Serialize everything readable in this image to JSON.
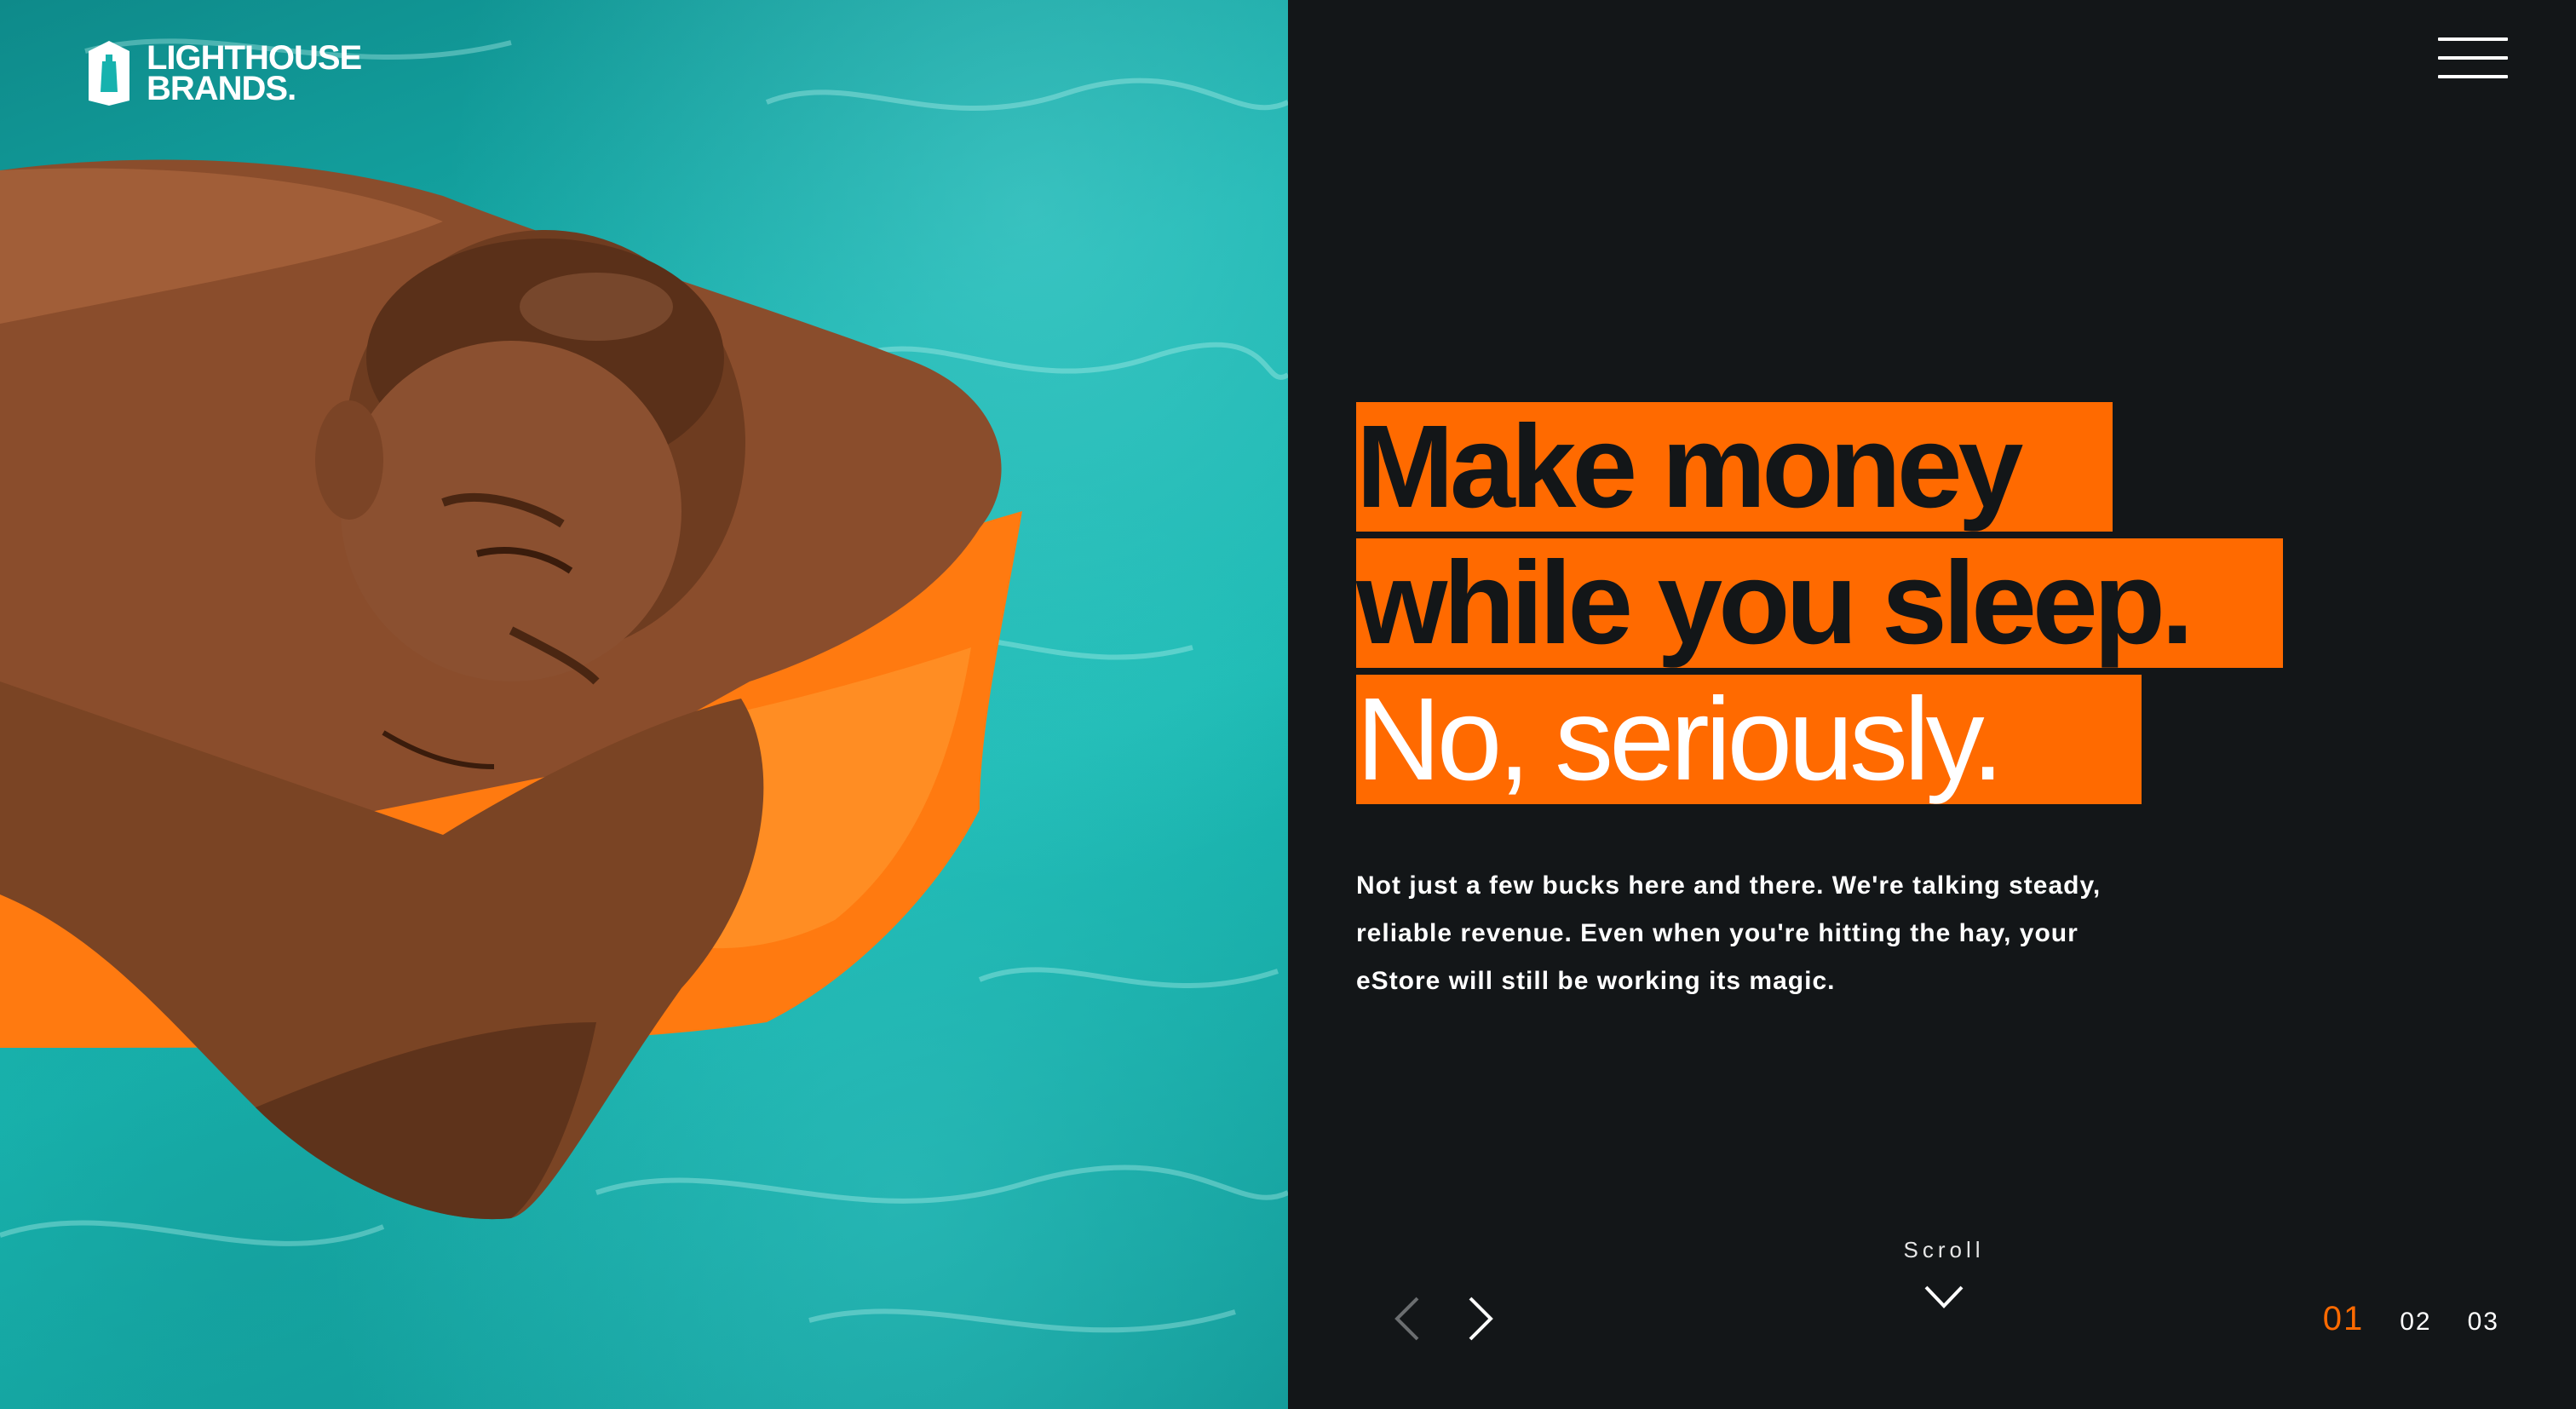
{
  "brand": {
    "line1": "LIGHTHOUSE",
    "line2": "BRANDS."
  },
  "hero": {
    "line1": "Make money",
    "line2": "while you sleep.",
    "line3": "No, seriously.",
    "body": "Not just a few bucks here and there. We're talking steady, reliable revenue. Even when you're hitting the hay, your eStore will still be working its magic."
  },
  "nav": {
    "scroll_label": "Scroll",
    "pages": [
      "01",
      "02",
      "03"
    ],
    "active_page": "01"
  },
  "colors": {
    "accent": "#ff6a00",
    "panel": "#131618",
    "pool": "#17b2ae"
  },
  "icons": {
    "menu": "hamburger-icon",
    "prev": "chevron-left-icon",
    "next": "chevron-right-icon",
    "scroll": "chevron-down-icon",
    "logo": "lighthouse-icon"
  }
}
